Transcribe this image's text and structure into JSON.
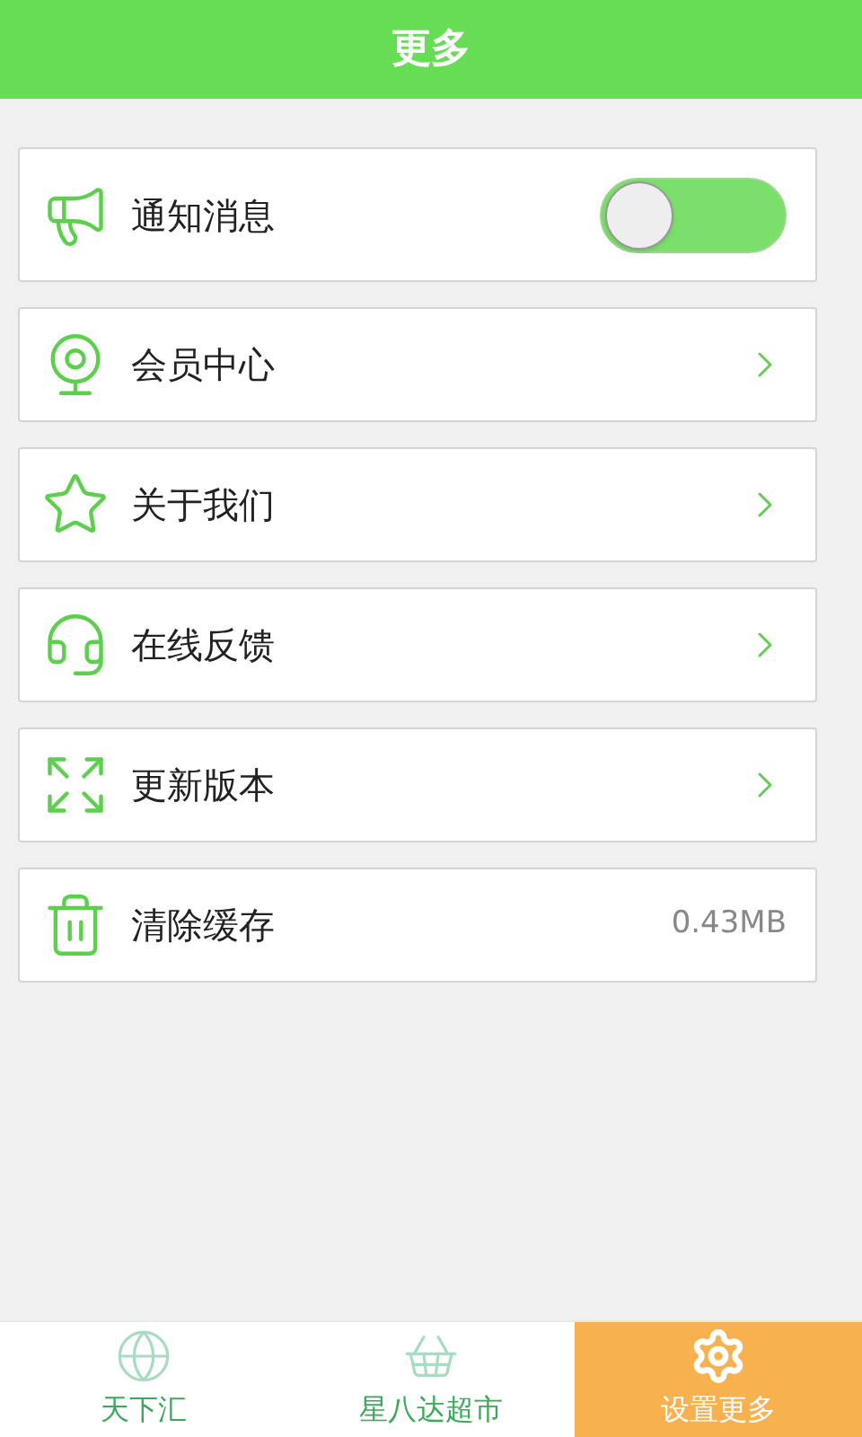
{
  "header": {
    "title": "更多"
  },
  "items": [
    {
      "kind": "toggle",
      "label": "通知消息",
      "on": false
    },
    {
      "kind": "link",
      "label": "会员中心"
    },
    {
      "kind": "link",
      "label": "关于我们"
    },
    {
      "kind": "link",
      "label": "在线反馈"
    },
    {
      "kind": "link",
      "label": "更新版本"
    },
    {
      "kind": "value",
      "label": "清除缓存",
      "value": "0.43MB"
    }
  ],
  "tabs": [
    {
      "label": "天下汇",
      "selected": false
    },
    {
      "label": "星八达超市",
      "selected": false
    },
    {
      "label": "设置更多",
      "selected": true
    }
  ]
}
